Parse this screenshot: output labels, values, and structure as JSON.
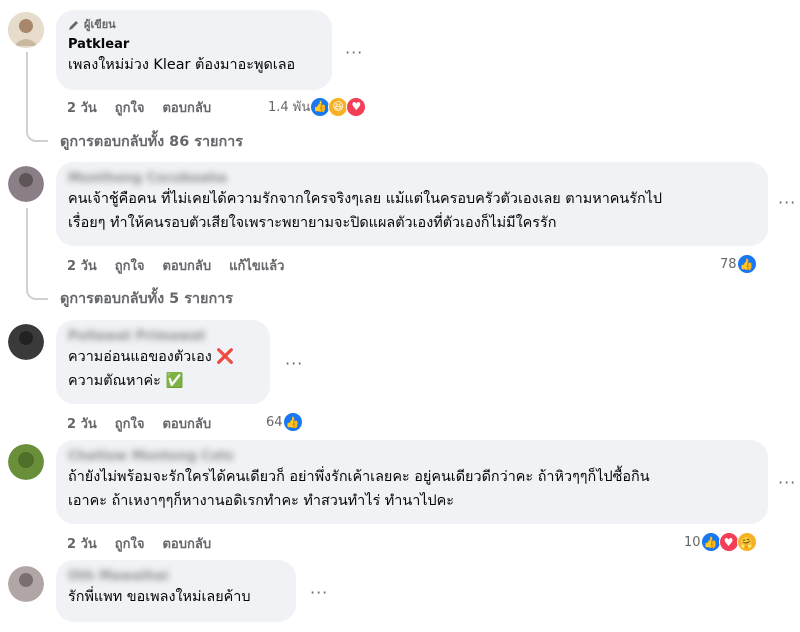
{
  "comments": [
    {
      "badge": "ผู้เขียน",
      "author": "Patklear",
      "text": "เพลงใหม่ม่วง Klear ต้องมาอะพูดเลอ",
      "time": "2 วัน",
      "like": "ถูกใจ",
      "reply": "ตอบกลับ",
      "reaction_count": "1.4 พัน",
      "reaction_icons": [
        "like-icon",
        "haha-icon",
        "love-icon"
      ],
      "view_replies": "ดูการตอบกลับทั้ง 86 รายการ",
      "avatar_color": "#c9b8a0"
    },
    {
      "author": "Monthong Cocoboaha",
      "text": "คนเจ้าชู้คือคน ที่ไม่เคยได้ความรักจากใครจริงๆเลย แม้แต่ในครอบครัวตัวเองเลย ตามหาคนรักไป\nเรื่อยๆ ทำให้คนรอบตัวเสียใจเพราะพยายามจะปิดแผลตัวเองที่ตัวเองก็ไม่มีใครรัก",
      "time": "2 วัน",
      "like": "ถูกใจ",
      "reply": "ตอบกลับ",
      "edited": "แก้ไขแล้ว",
      "reaction_count": "78",
      "reaction_icons": [
        "like-icon"
      ],
      "view_replies": "ดูการตอบกลับทั้ง 5 รายการ",
      "avatar_color": "#8a7f86"
    },
    {
      "author": "Pollawat Primawat",
      "text": "ความอ่อนแอของตัวเอง ❌\nความตัณหาค่ะ ✅",
      "time": "2 วัน",
      "like": "ถูกใจ",
      "reply": "ตอบกลับ",
      "reaction_count": "64",
      "reaction_icons": [
        "like-icon"
      ],
      "avatar_color": "#3a3a3a"
    },
    {
      "author": "Chatlow Montong Cots",
      "text": "ถ้ายังไม่พร้อมจะรักใครได้คนเดียวก็ อย่าพึ่งรักเค้าเลยคะ อยู่คนเดียวดีกว่าคะ ถ้าหิวๆๆก็ไปซื้อกิน\nเอาคะ ถ้าเหงาๆๆก็หางานอดิเรกทำคะ ทำสวนทำไร่ ทำนาไปคะ",
      "time": "2 วัน",
      "like": "ถูกใจ",
      "reply": "ตอบกลับ",
      "reaction_count": "10",
      "reaction_icons": [
        "like-icon",
        "love-icon",
        "care-icon"
      ],
      "avatar_color": "#6a8f3a"
    },
    {
      "author": "Oth Mawaihai",
      "text": "รักพี่แพท ขอเพลงใหม่เลยค้าบ",
      "avatar_color": "#b0a6a6"
    }
  ],
  "more_label": "···"
}
